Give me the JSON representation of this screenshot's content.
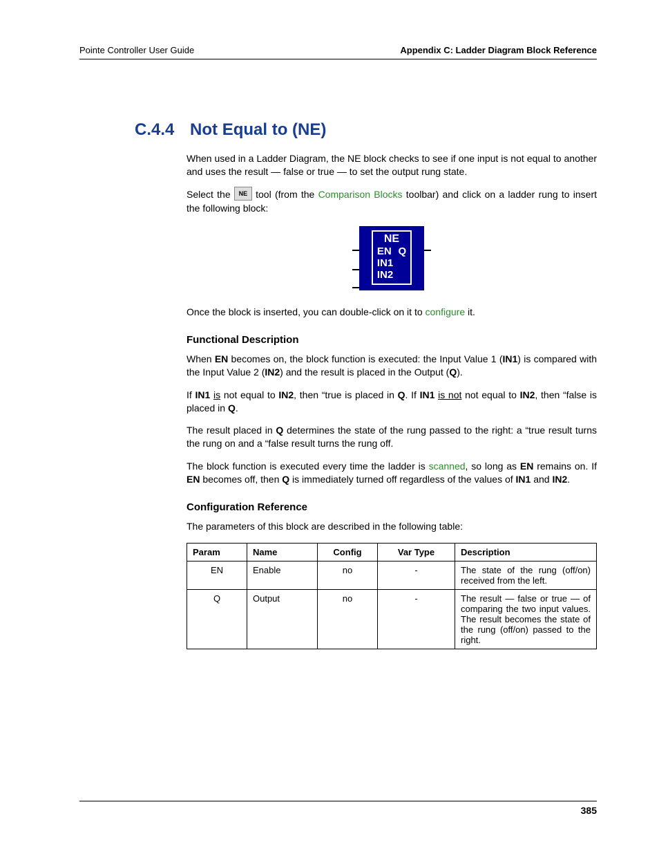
{
  "header": {
    "left": "Pointe Controller User Guide",
    "right": "Appendix C: Ladder Diagram Block Reference"
  },
  "section": {
    "number": "C.4.4",
    "title": "Not Equal to (NE)"
  },
  "paragraphs": {
    "intro": "When used in a Ladder Diagram, the NE block checks to see if one input is not equal to another and uses the result — false or true — to set the output rung state.",
    "select_pre": "Select the ",
    "select_mid": " tool (from the ",
    "select_link": "Comparison Blocks",
    "select_post": " toolbar) and click on a ladder rung to insert the following block:",
    "once_pre": "Once the block is inserted, you can double-click on it to ",
    "once_link": "configure",
    "once_post": " it."
  },
  "tool_label": "NE",
  "ne_block": {
    "title": "NE",
    "en": "EN",
    "q": "Q",
    "in1": "IN1",
    "in2": "IN2"
  },
  "functional": {
    "heading": "Functional Description",
    "p1_a": "When ",
    "p1_en": "EN",
    "p1_b": " becomes on, the block function is executed: the Input Value 1 (",
    "p1_in1": "IN1",
    "p1_c": ") is compared with the Input Value 2 (",
    "p1_in2": "IN2",
    "p1_d": ") and the result is placed in the Output (",
    "p1_q": "Q",
    "p1_e": ").",
    "p2_a": "If ",
    "p2_in1": "IN1",
    "p2_b": " ",
    "p2_u1": "is",
    "p2_c": " not equal to ",
    "p2_in2": "IN2",
    "p2_d": ", then “true is placed in ",
    "p2_q1": "Q",
    "p2_e": ". If ",
    "p2_in1b": "IN1",
    "p2_f": " ",
    "p2_u2": "is not",
    "p2_g": " not equal to ",
    "p2_in2b": "IN2",
    "p2_h": ", then “false is placed in ",
    "p2_q2": "Q",
    "p2_i": ".",
    "p3_a": "The result placed in ",
    "p3_q": "Q",
    "p3_b": " determines the state of the rung passed to the right: a “true result turns the rung on and a “false result turns the rung off.",
    "p4_a": "The block function is executed every time the ladder is ",
    "p4_link": "scanned",
    "p4_b": ", so long as ",
    "p4_en": "EN",
    "p4_c": " remains on. If ",
    "p4_en2": "EN",
    "p4_d": " becomes off, then ",
    "p4_q": "Q",
    "p4_e": " is immediately turned off regardless of the values of ",
    "p4_in1": "IN1",
    "p4_f": " and ",
    "p4_in2": "IN2",
    "p4_g": "."
  },
  "config": {
    "heading": "Configuration Reference",
    "intro": "The parameters of this block are described in the following table:"
  },
  "table": {
    "headers": [
      "Param",
      "Name",
      "Config",
      "Var Type",
      "Description"
    ],
    "rows": [
      {
        "param": "EN",
        "name": "Enable",
        "config": "no",
        "vartype": "-",
        "desc": "The state of the rung (off/on) received from the left."
      },
      {
        "param": "Q",
        "name": "Output",
        "config": "no",
        "vartype": "-",
        "desc": "The result — false or true — of comparing the two input values. The result becomes the state of the rung (off/on) passed to the right."
      }
    ]
  },
  "page_number": "385"
}
